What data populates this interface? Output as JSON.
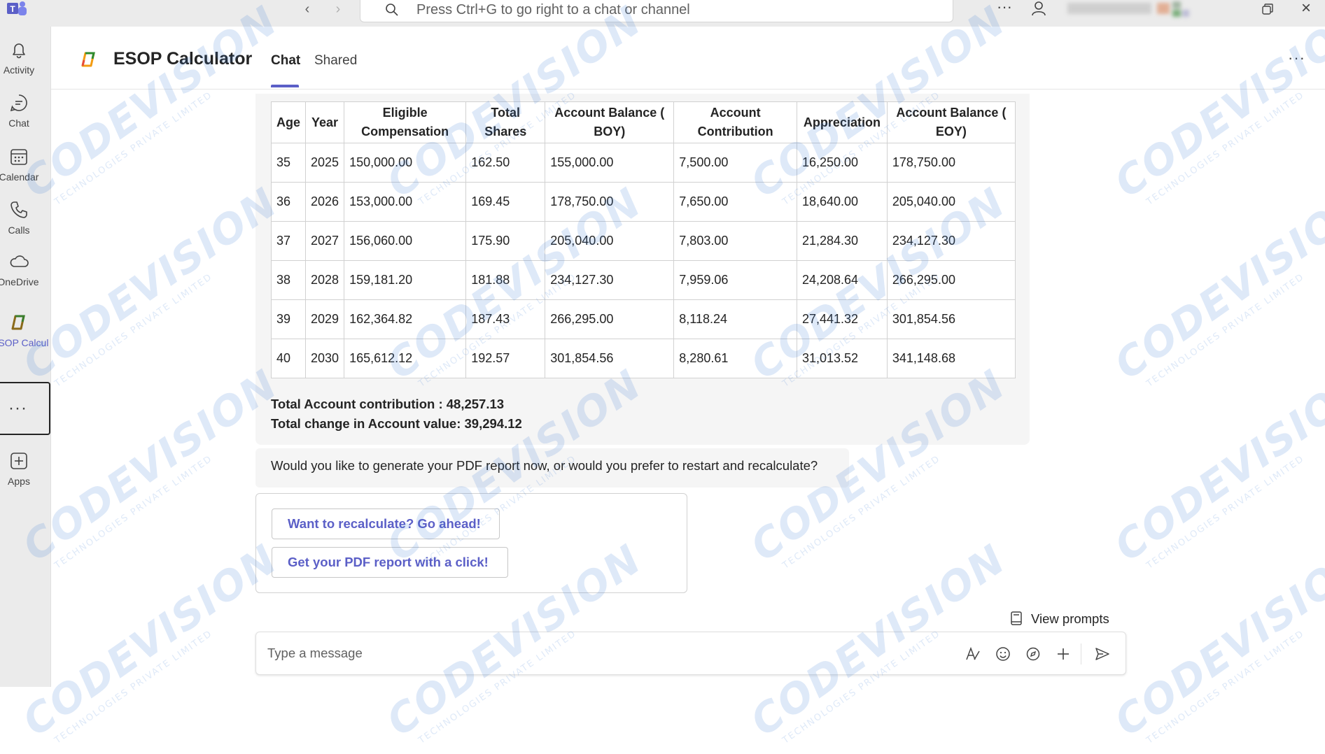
{
  "titlebar": {
    "search_placeholder": "Press Ctrl+G to go right to a chat or channel"
  },
  "rail": {
    "items": [
      {
        "label": "Activity",
        "icon": "bell-icon"
      },
      {
        "label": "Chat",
        "icon": "chat-icon"
      },
      {
        "label": "Calendar",
        "icon": "calendar-icon"
      },
      {
        "label": "Calls",
        "icon": "phone-icon"
      },
      {
        "label": "OneDrive",
        "icon": "cloud-icon"
      },
      {
        "label": "ESOP Calcul...",
        "icon": "esop-app-icon"
      },
      {
        "label": "Apps",
        "icon": "add-app-icon"
      }
    ]
  },
  "header": {
    "app_title": "ESOP Calculator",
    "tabs": [
      {
        "label": "Chat",
        "active": true
      },
      {
        "label": "Shared",
        "active": false
      }
    ]
  },
  "table": {
    "headers": [
      "Age",
      "Year",
      "Eligible Compensation",
      "Total Shares",
      "Account Balance ( BOY)",
      "Account Contribution",
      "Appreciation",
      "Account Balance ( EOY)"
    ],
    "rows": [
      [
        "35",
        "2025",
        "150,000.00",
        "162.50",
        "155,000.00",
        "7,500.00",
        "16,250.00",
        "178,750.00"
      ],
      [
        "36",
        "2026",
        "153,000.00",
        "169.45",
        "178,750.00",
        "7,650.00",
        "18,640.00",
        "205,040.00"
      ],
      [
        "37",
        "2027",
        "156,060.00",
        "175.90",
        "205,040.00",
        "7,803.00",
        "21,284.30",
        "234,127.30"
      ],
      [
        "38",
        "2028",
        "159,181.20",
        "181.88",
        "234,127.30",
        "7,959.06",
        "24,208.64",
        "266,295.00"
      ],
      [
        "39",
        "2029",
        "162,364.82",
        "187.43",
        "266,295.00",
        "8,118.24",
        "27,441.32",
        "301,854.56"
      ],
      [
        "40",
        "2030",
        "165,612.12",
        "192.57",
        "301,854.56",
        "8,280.61",
        "31,013.52",
        "341,148.68"
      ]
    ]
  },
  "totals": {
    "contribution": "Total Account contribution : 48,257.13",
    "change": "Total change in Account value: 39,294.12"
  },
  "question": "Would you like to generate your PDF report now, or would you prefer to restart and recalculate?",
  "card": {
    "recalc_label": "Want to recalculate? Go ahead!",
    "pdf_label": "Get your PDF report with a click!"
  },
  "view_prompts_label": "View prompts",
  "composer": {
    "placeholder": "Type a message"
  },
  "watermark": {
    "main": "CODEVISION",
    "sub": "TECHNOLOGIES PRIVATE LIMITED"
  },
  "colors": {
    "accent": "#5b5fc7",
    "rail_bg": "#ebebeb",
    "bubble_bg": "#f5f5f5"
  }
}
